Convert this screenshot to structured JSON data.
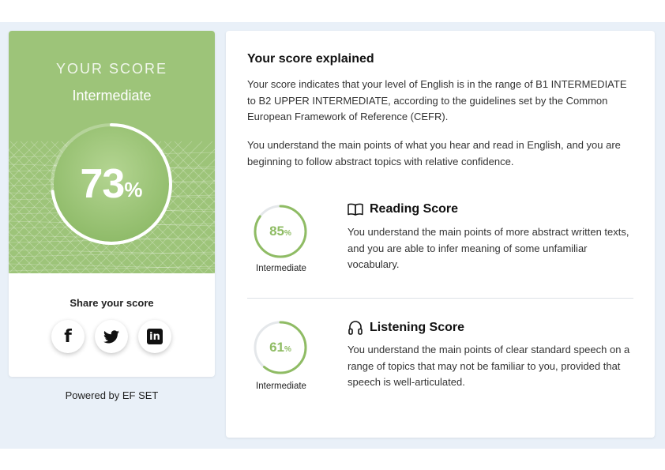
{
  "colors": {
    "accent_green": "#9dc479",
    "score_green": "#8fbc64",
    "band_bg": "#e9f0f8"
  },
  "score_card": {
    "label": "YOUR SCORE",
    "level": "Intermediate",
    "score": "73",
    "score_percent": 73,
    "percent_sign": "%",
    "share_title": "Share your score",
    "social": [
      {
        "name": "facebook",
        "icon": "facebook-icon",
        "glyph": "f"
      },
      {
        "name": "twitter",
        "icon": "twitter-icon"
      },
      {
        "name": "linkedin",
        "icon": "linkedin-icon",
        "glyph": "in"
      }
    ]
  },
  "powered_by": "Powered by EF SET",
  "explanation": {
    "title": "Your score explained",
    "paragraph1": "Your score indicates that your level of English is in the range of B1 INTERMEDIATE to B2 UPPER INTERMEDIATE, according to the guidelines set by the Common European Framework of Reference (CEFR).",
    "paragraph2": "You understand the main points of what you hear and read in English, and you are beginning to follow abstract topics with relative confidence.",
    "reading": {
      "title": "Reading Score",
      "icon": "book-icon",
      "score": "85",
      "score_percent": 85,
      "percent_sign": "%",
      "level": "Intermediate",
      "text": "You understand the main points of more abstract written texts, and you are able to infer meaning of some unfamiliar vocabulary."
    },
    "listening": {
      "title": "Listening Score",
      "icon": "headphones-icon",
      "score": "61",
      "score_percent": 61,
      "percent_sign": "%",
      "level": "Intermediate",
      "text": "You understand the main points of clear standard speech on a range of topics that may not be familiar to you, provided that speech is well-articulated."
    }
  }
}
